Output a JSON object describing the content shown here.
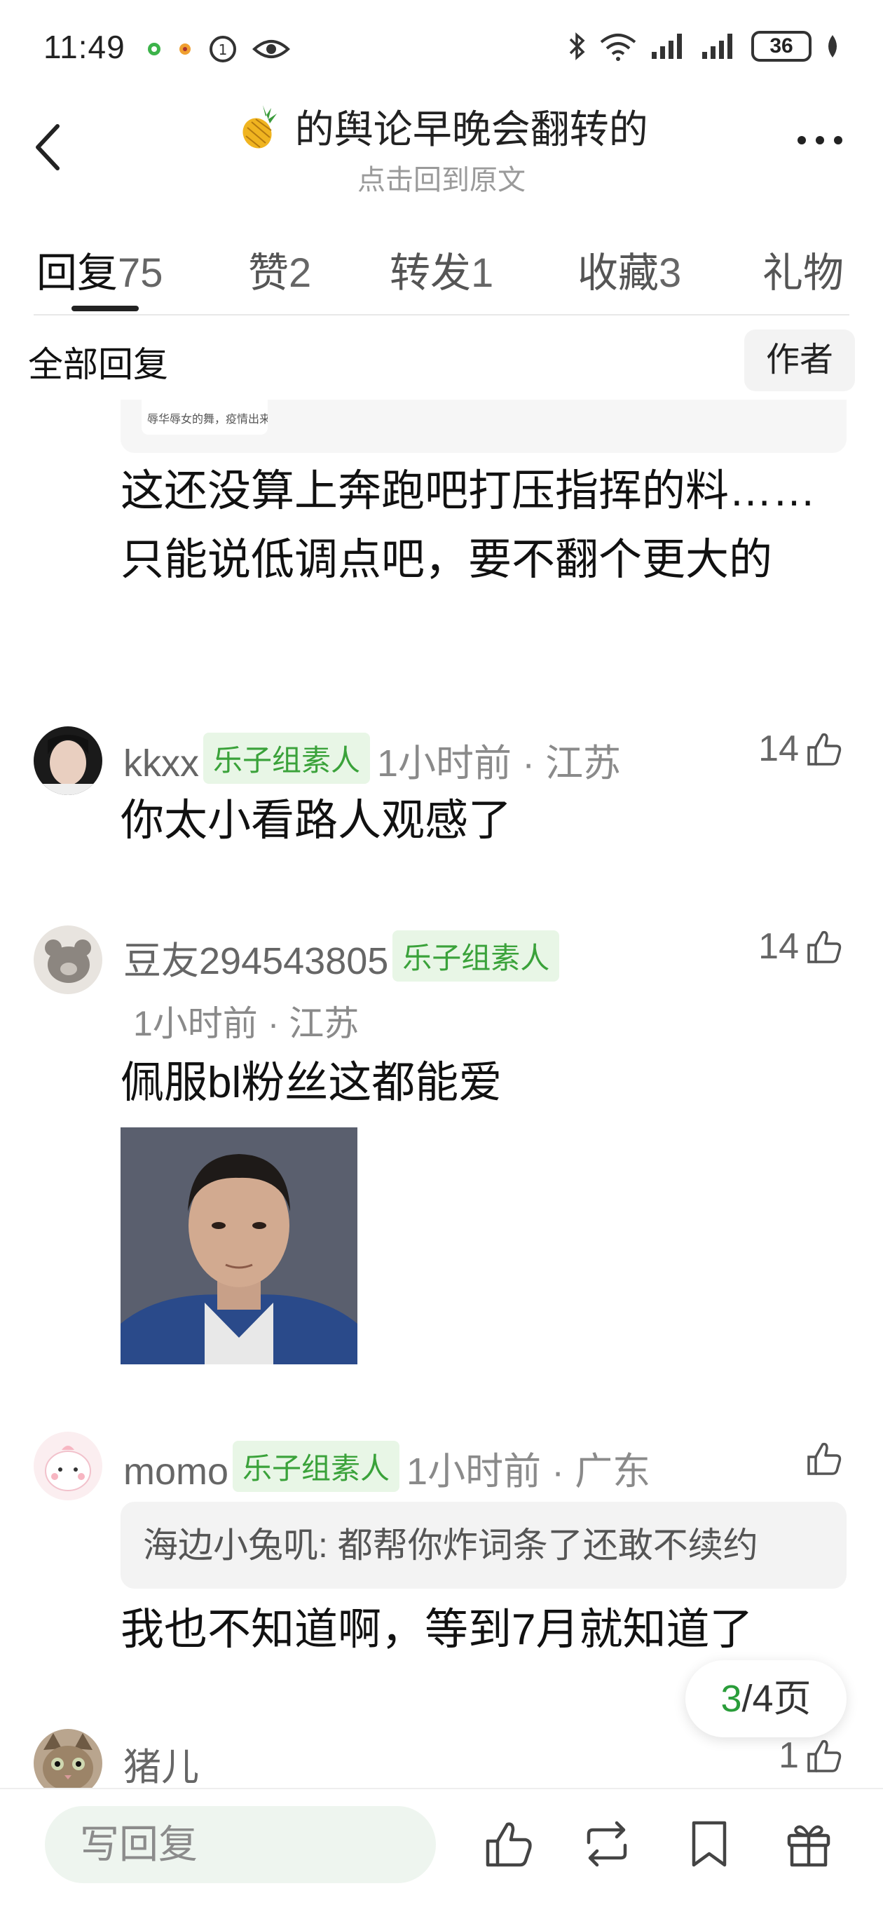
{
  "status_bar": {
    "time": "11:49",
    "battery": "36",
    "icons": [
      "wechat-icon",
      "notification-dot-icon",
      "sync-icon",
      "eye-icon",
      "bluetooth-icon",
      "wifi-icon",
      "signal-icon",
      "signal-icon",
      "battery-icon",
      "leaf-icon"
    ]
  },
  "title_bar": {
    "title": "的舆论早晚会翻转的",
    "subtitle": "点击回到原文"
  },
  "tabs": [
    {
      "label": "回复",
      "count": "75"
    },
    {
      "label": "赞",
      "count": "2"
    },
    {
      "label": "转发",
      "count": "1"
    },
    {
      "label": "收藏",
      "count": "3"
    },
    {
      "label": "礼物",
      "count": ""
    }
  ],
  "filter": {
    "all_label": "全部回复",
    "author_label": "作者"
  },
  "quote_stub_text": "辱华辱女的舞，疫情出来跳",
  "first_comment_text": "这还没算上奔跑吧打压指挥的料……只能说低调点吧，要不翻个更大的",
  "comments": [
    {
      "username": "kkxx",
      "badge": "乐子组素人",
      "time": "1小时前",
      "location": "江苏",
      "likes": "14",
      "text": "你太小看路人观感了"
    },
    {
      "username": "豆友294543805",
      "badge": "乐子组素人",
      "time": "1小时前",
      "location": "江苏",
      "likes": "14",
      "text": "佩服bl粉丝这都能爱"
    },
    {
      "username": "momo",
      "badge": "乐子组素人",
      "time": "1小时前",
      "location": "广东",
      "likes": "",
      "quote": "海边小兔叽: 都帮你炸词条了还敢不续约",
      "text": "我也不知道啊，等到7月就知道了"
    },
    {
      "username": "猪儿",
      "likes": "1"
    }
  ],
  "page_indicator": {
    "current": "3",
    "total_label": "/4页"
  },
  "bottom_bar": {
    "reply_placeholder": "写回复"
  },
  "colors": {
    "accent_green": "#3aa23a",
    "badge_bg": "#e8f6e6",
    "input_bg": "#eef5ef"
  }
}
